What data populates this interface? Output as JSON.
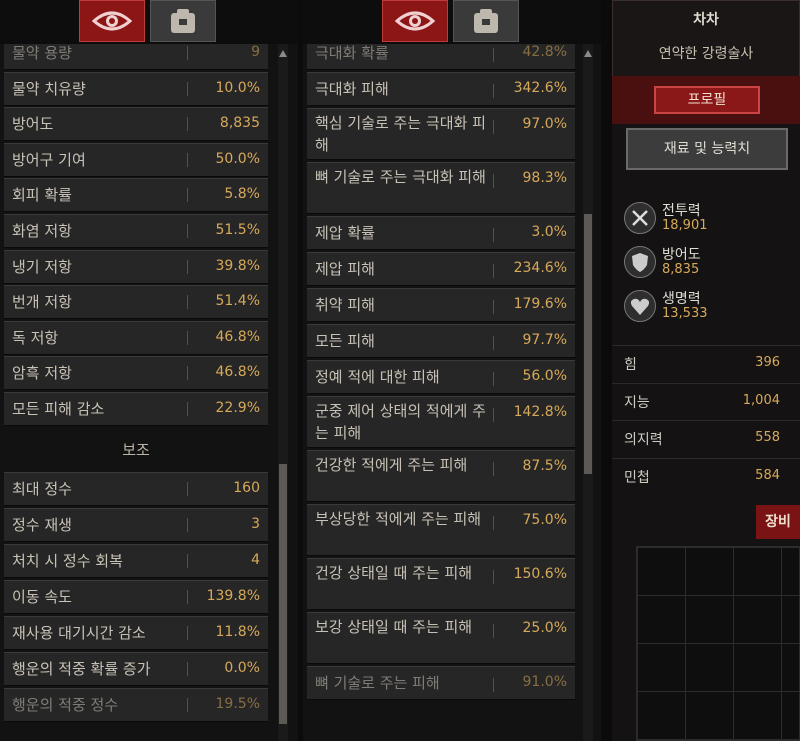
{
  "left_panel": {
    "rows_top": [
      {
        "label": "물약 용량",
        "value": "9"
      },
      {
        "label": "물약 치유량",
        "value": "10.0%"
      },
      {
        "label": "방어도",
        "value": "8,835"
      },
      {
        "label": "방어구 기여",
        "value": "50.0%"
      },
      {
        "label": "회피 확률",
        "value": "5.8%"
      },
      {
        "label": "화염 저항",
        "value": "51.5%"
      },
      {
        "label": "냉기 저항",
        "value": "39.8%"
      },
      {
        "label": "번개 저항",
        "value": "51.4%"
      },
      {
        "label": "독 저항",
        "value": "46.8%"
      },
      {
        "label": "암흑 저항",
        "value": "46.8%"
      },
      {
        "label": "모든 피해 감소",
        "value": "22.9%"
      }
    ],
    "section_title": "보조",
    "rows_bottom": [
      {
        "label": "최대 정수",
        "value": "160"
      },
      {
        "label": "정수 재생",
        "value": "3"
      },
      {
        "label": "처치 시 정수 회복",
        "value": "4"
      },
      {
        "label": "이동 속도",
        "value": "139.8%"
      },
      {
        "label": "재사용 대기시간 감소",
        "value": "11.8%"
      },
      {
        "label": "행운의 적중 확률 증가",
        "value": "0.0%"
      },
      {
        "label": "행운의 적중 정수",
        "value": "19.5%"
      }
    ]
  },
  "right_list": [
    {
      "label": "극대화 확률",
      "value": "42.8%"
    },
    {
      "label": "극대화 피해",
      "value": "342.6%"
    },
    {
      "label": "핵심 기술로 주는 극대화 피해",
      "value": "97.0%"
    },
    {
      "label": "뼈 기술로 주는 극대화 피해",
      "value": "98.3%"
    },
    {
      "label": "제압 확률",
      "value": "3.0%"
    },
    {
      "label": "제압 피해",
      "value": "234.6%"
    },
    {
      "label": "취약 피해",
      "value": "179.6%"
    },
    {
      "label": "모든 피해",
      "value": "97.7%"
    },
    {
      "label": "정예 적에 대한 피해",
      "value": "56.0%"
    },
    {
      "label": "군중 제어 상태의 적에게 주는 피해",
      "value": "142.8%"
    },
    {
      "label": "건강한 적에게 주는 피해",
      "value": "87.5%"
    },
    {
      "label": "부상당한 적에게 주는 피해",
      "value": "75.0%"
    },
    {
      "label": "건강 상태일 때 주는 피해",
      "value": "150.6%"
    },
    {
      "label": "보강 상태일 때 주는 피해",
      "value": "25.0%"
    },
    {
      "label": "뼈 기술로 주는 피해",
      "value": "91.0%"
    }
  ],
  "character": {
    "name": "차차",
    "class": "연약한 강령술사",
    "profile_button": "프로필",
    "materials_button": "재료 및 능력치",
    "core_stats": [
      {
        "name": "전투력",
        "value": "18,901",
        "icon": "crossed-swords-icon"
      },
      {
        "name": "방어도",
        "value": "8,835",
        "icon": "shield-icon"
      },
      {
        "name": "생명력",
        "value": "13,533",
        "icon": "heart-icon"
      }
    ],
    "attributes": [
      {
        "name": "힘",
        "value": "396"
      },
      {
        "name": "지능",
        "value": "1,004"
      },
      {
        "name": "의지력",
        "value": "558"
      },
      {
        "name": "민첩",
        "value": "584"
      }
    ],
    "equipment_tab": "장비"
  },
  "colors": {
    "accent_red": "#8c1515",
    "value_gold": "#d7a95a"
  }
}
